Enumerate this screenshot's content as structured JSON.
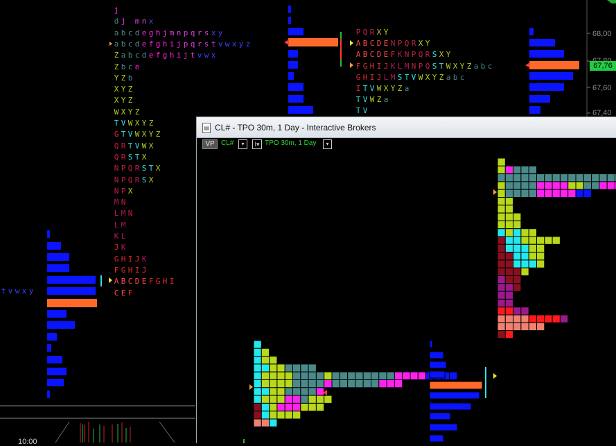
{
  "window": {
    "title": "CL# - TPO 30m, 1 Day - Interactive Brokers",
    "vp_label": "VP",
    "symbol": "CL#",
    "dropdown_glyph": "▾",
    "bars_glyph": "I▾",
    "timeframe": "TPO 30m, 1 Day"
  },
  "price_axis": {
    "labels": [
      "68,00",
      "67,80",
      "67,60",
      "67,40"
    ],
    "last_price": "67,76"
  },
  "time_axis": {
    "label": "10:00"
  },
  "colors": {
    "volume_bar": "#0a14ff",
    "poc_bar": "#ff6a2a",
    "last_price_badge": "#22cc44"
  },
  "left_profile_rows": [
    {
      "text": "j"
    },
    {
      "text": "dj mnx"
    },
    {
      "text": "abcdeghjmnpqrsxy"
    },
    {
      "text": "abcdefghijpqrstvwxyz"
    },
    {
      "text": "Zabcdefghijtvwx"
    },
    {
      "text": "Zbce"
    },
    {
      "text": "YZb"
    },
    {
      "text": "XYZ"
    },
    {
      "text": "XYZ"
    },
    {
      "text": "WXYZ"
    },
    {
      "text": "TVWXYZ"
    },
    {
      "text": "GTVWXYZ"
    },
    {
      "text": "QRTVWX"
    },
    {
      "text": "QRSTX"
    },
    {
      "text": "NPQRSTX"
    },
    {
      "text": "NPQRSX"
    },
    {
      "text": "NPX"
    },
    {
      "text": "MN"
    },
    {
      "text": "LMN"
    },
    {
      "text": "LM"
    },
    {
      "text": "KL"
    },
    {
      "text": "JK"
    },
    {
      "text": "GHIJK"
    },
    {
      "text": "FGHIJ"
    },
    {
      "text": "ABCDEFGHI"
    },
    {
      "text": "CEF"
    }
  ],
  "left_lower_fragment": {
    "text": "tvwxy"
  },
  "right_profile_rows": [
    {
      "text": "PQRXY"
    },
    {
      "text": "ABCDENPQRXY"
    },
    {
      "text": "ABCDEFKNPQRSXY"
    },
    {
      "text": "FGHIJKLMNPQSTWXYZabc"
    },
    {
      "text": "GHIJLMSTVWXYZabc"
    },
    {
      "text": "ITVWXYZa"
    },
    {
      "text": "TVWZa"
    },
    {
      "text": "TV"
    }
  ]
}
